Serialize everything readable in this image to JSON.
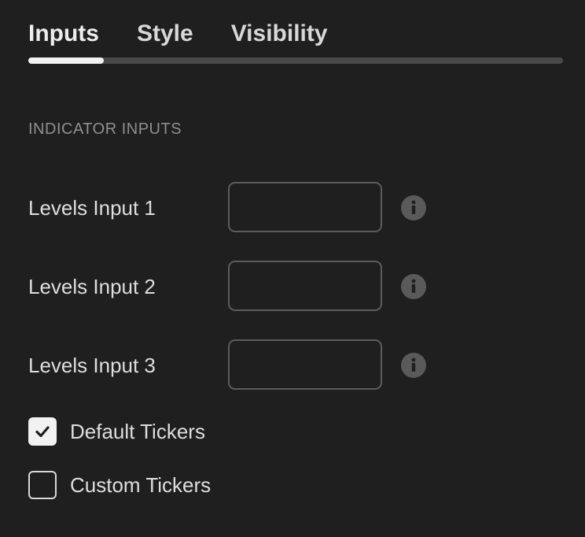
{
  "tabs": [
    {
      "label": "Inputs",
      "active": true
    },
    {
      "label": "Style",
      "active": false
    },
    {
      "label": "Visibility",
      "active": false
    }
  ],
  "section": {
    "title": "INDICATOR INPUTS"
  },
  "inputs": [
    {
      "label": "Levels Input 1",
      "value": "",
      "info_icon": "info-icon"
    },
    {
      "label": "Levels Input 2",
      "value": "",
      "info_icon": "info-icon"
    },
    {
      "label": "Levels Input 3",
      "value": "",
      "info_icon": "info-icon"
    }
  ],
  "checkboxes": [
    {
      "label": "Default Tickers",
      "checked": true
    },
    {
      "label": "Custom Tickers",
      "checked": false
    }
  ],
  "colors": {
    "background": "#1f1f1f",
    "tab_indicator": "#f2f2f2",
    "tab_track": "#4a4a4a",
    "input_border": "#5c5c5c",
    "info_icon": "#5a5a5a"
  }
}
